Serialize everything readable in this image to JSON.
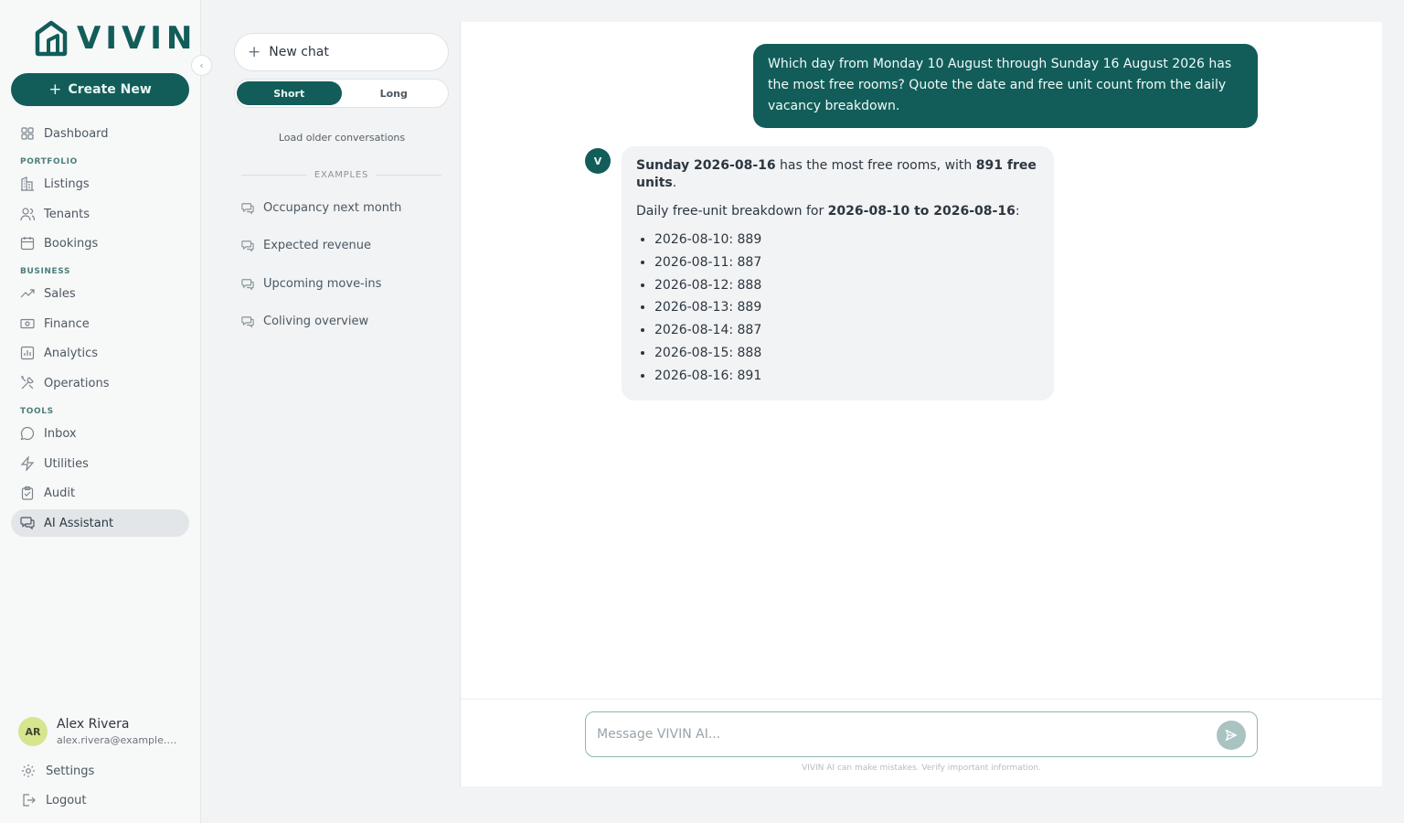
{
  "brand": {
    "name": "VIVIN",
    "accent": "#125d5a"
  },
  "nav": {
    "create_label": "Create New",
    "items": [
      {
        "label": "Dashboard",
        "icon": "grid-icon"
      },
      {
        "label": "Listings",
        "icon": "buildings-icon"
      },
      {
        "label": "Tenants",
        "icon": "users-icon"
      },
      {
        "label": "Bookings",
        "icon": "calendar-icon"
      },
      {
        "label": "Sales",
        "icon": "trending-up-icon"
      },
      {
        "label": "Finance",
        "icon": "banknote-icon"
      },
      {
        "label": "Analytics",
        "icon": "bar-chart-icon"
      },
      {
        "label": "Operations",
        "icon": "tools-icon"
      },
      {
        "label": "Inbox",
        "icon": "message-circle-icon"
      },
      {
        "label": "Utilities",
        "icon": "zap-icon"
      },
      {
        "label": "Audit",
        "icon": "clipboard-icon"
      },
      {
        "label": "AI Assistant",
        "icon": "chat-bubbles-icon",
        "active": true
      }
    ],
    "sections": [
      "PORTFOLIO",
      "BUSINESS",
      "TOOLS"
    ],
    "user": {
      "initials": "AR",
      "name": "Alex Rivera",
      "email": "alex.rivera@example.c..."
    },
    "settings_label": "Settings",
    "logout_label": "Logout"
  },
  "conversations": {
    "new_chat_label": "New chat",
    "toggle": {
      "short": "Short",
      "long": "Long",
      "selected": "Short"
    },
    "load_older_label": "Load older conversations",
    "examples_heading": "EXAMPLES",
    "examples": [
      "Occupancy next month",
      "Expected revenue",
      "Upcoming move-ins",
      "Coliving overview"
    ]
  },
  "chat": {
    "user_message": "Which day from Monday 10 August through Sunday 16 August 2026 has the most free rooms? Quote the date and free unit count from the daily vacancy breakdown.",
    "bot_avatar": "V",
    "answer": {
      "best_day": "Sunday 2026-08-16",
      "mid_text": " has the most free rooms, with ",
      "best_count": "891 free units",
      "end_text": ".",
      "breakdown_intro": "Daily free-unit breakdown for ",
      "breakdown_range": "2026-08-10 to 2026-08-16",
      "breakdown_colon": ":",
      "rows": [
        "2026-08-10: 889",
        "2026-08-11: 887",
        "2026-08-12: 888",
        "2026-08-13: 889",
        "2026-08-14: 887",
        "2026-08-15: 888",
        "2026-08-16: 891"
      ]
    },
    "composer_placeholder": "Message VIVIN AI...",
    "disclaimer": "VIVIN AI can make mistakes. Verify important information."
  }
}
